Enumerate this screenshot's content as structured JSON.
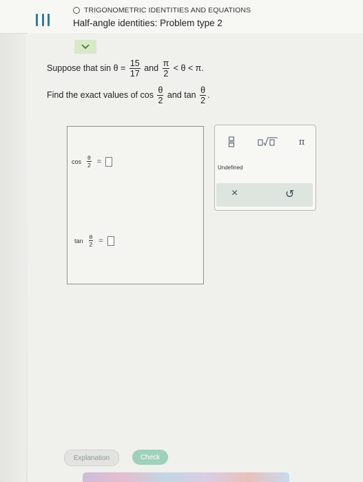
{
  "header": {
    "topic": "TRIGONOMETRIC IDENTITIES AND EQUATIONS",
    "title": "Half-angle identities: Problem type 2"
  },
  "problem": {
    "suppose": "Suppose that",
    "sin_lhs": "sin θ =",
    "sin_num": "15",
    "sin_den": "17",
    "and1": "and",
    "pi_num": "π",
    "pi_den": "2",
    "range_rest": "< θ < π.",
    "find": "Find the exact values of",
    "cos": "cos",
    "half_num": "θ",
    "half_den": "2",
    "and2": "and",
    "tan": "tan",
    "period": "."
  },
  "answers": {
    "cos_label": "cos",
    "tan_label": "tan",
    "theta": "θ",
    "two": "2",
    "eq": "="
  },
  "keypad": {
    "undefined_label": "Undefined",
    "pi_label": "π",
    "clear_label": "×",
    "undo_label": "↺"
  },
  "footer": {
    "explanation": "Explanation",
    "check": "Check"
  }
}
